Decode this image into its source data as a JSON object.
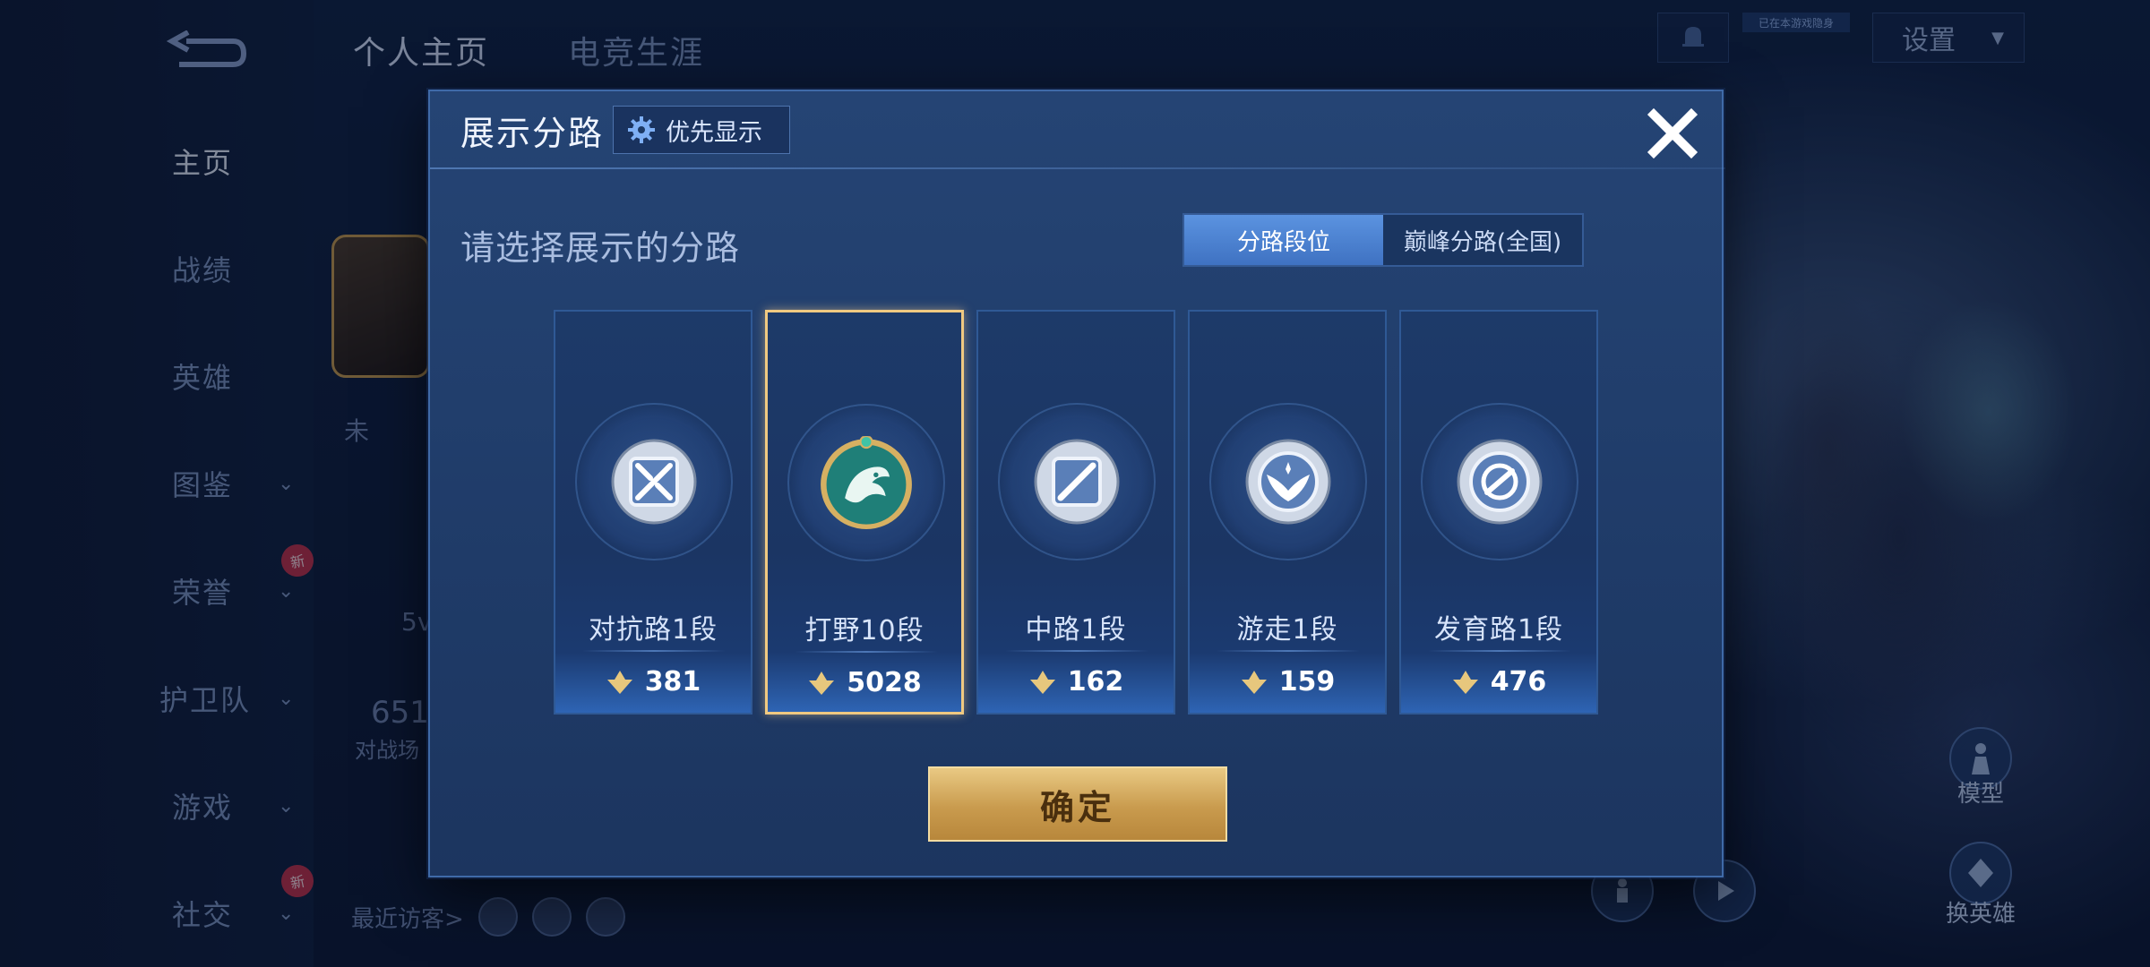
{
  "header": {
    "tabs": [
      {
        "label": "个人主页",
        "active": true
      },
      {
        "label": "电竞生涯",
        "active": false
      }
    ],
    "settings_label": "设置",
    "stealth_tag": "已在本游戏隐身"
  },
  "sidebar": {
    "items": [
      {
        "label": "主页",
        "active": true,
        "has_chevron": false,
        "new": false
      },
      {
        "label": "战绩",
        "active": false,
        "has_chevron": false,
        "new": false
      },
      {
        "label": "英雄",
        "active": false,
        "has_chevron": false,
        "new": false
      },
      {
        "label": "图鉴",
        "active": false,
        "has_chevron": true,
        "new": false
      },
      {
        "label": "荣誉",
        "active": false,
        "has_chevron": true,
        "new": true
      },
      {
        "label": "护卫队",
        "active": false,
        "has_chevron": true,
        "new": false
      },
      {
        "label": "游戏",
        "active": false,
        "has_chevron": true,
        "new": false
      },
      {
        "label": "社交",
        "active": false,
        "has_chevron": true,
        "new": true
      }
    ],
    "new_badge": "新"
  },
  "profile_underlay": {
    "status_partial": "未",
    "number_partial": "651",
    "match_partial": "对战场",
    "level_partial": "5v",
    "recent_visitors": "最近访客>"
  },
  "right_panel": {
    "model_label": "模型",
    "switch_hero_label": "换英雄"
  },
  "modal": {
    "title": "展示分路",
    "priority_label": "优先显示",
    "prompt": "请选择展示的分路",
    "segments": [
      {
        "label": "分路段位",
        "active": true
      },
      {
        "label": "巅峰分路(全国)",
        "active": false
      }
    ],
    "lanes": [
      {
        "rank": "对抗路1段",
        "score": "381",
        "selected": false,
        "emblem": "clash-lane-emblem"
      },
      {
        "rank": "打野10段",
        "score": "5028",
        "selected": true,
        "emblem": "jungle-dragon-emblem"
      },
      {
        "rank": "中路1段",
        "score": "162",
        "selected": false,
        "emblem": "mid-lane-emblem"
      },
      {
        "rank": "游走1段",
        "score": "159",
        "selected": false,
        "emblem": "roam-wings-emblem"
      },
      {
        "rank": "发育路1段",
        "score": "476",
        "selected": false,
        "emblem": "farm-lane-emblem"
      }
    ],
    "confirm_label": "确定"
  },
  "colors": {
    "accent_gold": "#e9c983",
    "selected_border": "#f0c981",
    "segment_active": "#4f86d6",
    "new_badge": "#c2314a"
  }
}
